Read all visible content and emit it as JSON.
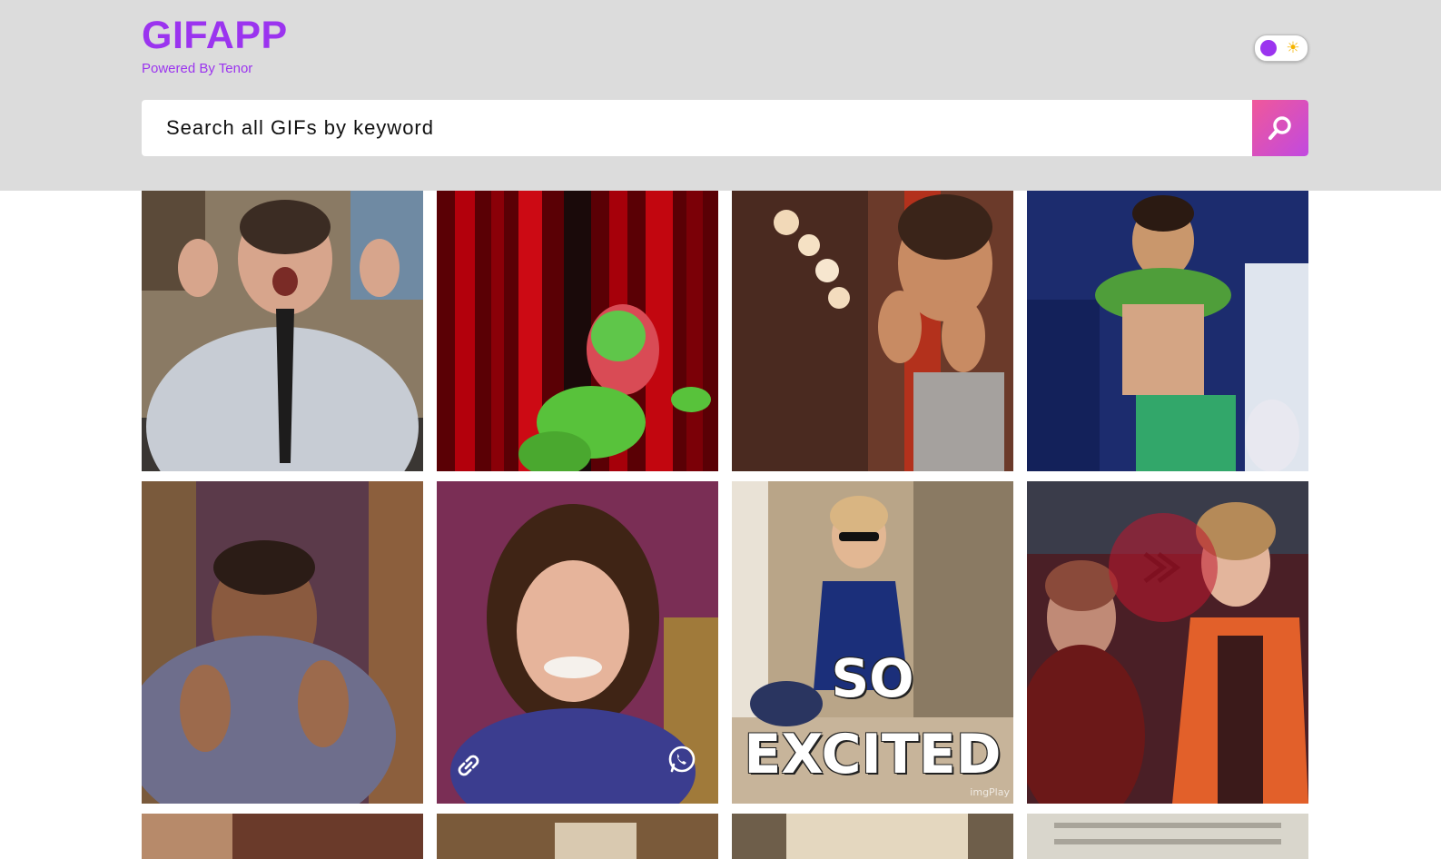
{
  "app": {
    "title": "GIFAPP",
    "subtitle": "Powered By Tenor",
    "accent_color": "#9b34ef"
  },
  "theme_toggle": {
    "knob_color": "#9b34ef",
    "icon": "sun-icon",
    "glyph": "☀"
  },
  "search": {
    "placeholder": "Search all GIFs by keyword",
    "button_icon": "search-icon"
  },
  "gifs": [
    {
      "id": "gif-1",
      "description_icon": "man-clapping-excited"
    },
    {
      "id": "gif-2",
      "description_icon": "kermit-frog-waving"
    },
    {
      "id": "gif-3",
      "description_icon": "child-excited"
    },
    {
      "id": "gif-4",
      "description_icon": "boy-shirt-celebrating"
    },
    {
      "id": "gif-5",
      "description_icon": "man-clapping"
    },
    {
      "id": "gif-6",
      "description_icon": "girl-grinning",
      "actions": [
        "link-icon",
        "whatsapp-icon"
      ]
    },
    {
      "id": "gif-7",
      "description_icon": "toddler-sunglasses",
      "caption_line1": "SO",
      "caption_line2": "EXCITED",
      "watermark": "imgPlay"
    },
    {
      "id": "gif-8",
      "description_icon": "women-screaming"
    },
    {
      "id": "gif-9"
    },
    {
      "id": "gif-10"
    },
    {
      "id": "gif-11"
    },
    {
      "id": "gif-12"
    }
  ]
}
